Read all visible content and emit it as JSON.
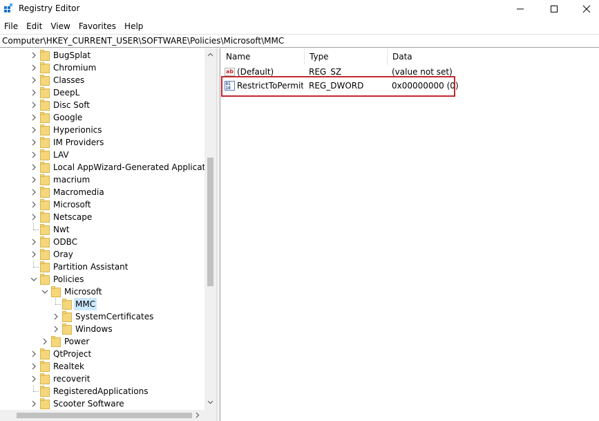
{
  "window": {
    "title": "Registry Editor",
    "controls": {
      "minimize": "minimize",
      "maximize": "maximize",
      "close": "close"
    }
  },
  "menu": [
    "File",
    "Edit",
    "View",
    "Favorites",
    "Help"
  ],
  "address": "Computer\\HKEY_CURRENT_USER\\SOFTWARE\\Policies\\Microsoft\\MMC",
  "tree": {
    "items": [
      {
        "label": "BugSplat",
        "level": 0,
        "expander": "collapsed"
      },
      {
        "label": "Chromium",
        "level": 0,
        "expander": "collapsed"
      },
      {
        "label": "Classes",
        "level": 0,
        "expander": "collapsed"
      },
      {
        "label": "DeepL",
        "level": 0,
        "expander": "collapsed"
      },
      {
        "label": "Disc Soft",
        "level": 0,
        "expander": "collapsed"
      },
      {
        "label": "Google",
        "level": 0,
        "expander": "collapsed"
      },
      {
        "label": "Hyperionics",
        "level": 0,
        "expander": "collapsed"
      },
      {
        "label": "IM Providers",
        "level": 0,
        "expander": "collapsed"
      },
      {
        "label": "LAV",
        "level": 0,
        "expander": "collapsed"
      },
      {
        "label": "Local AppWizard-Generated Applications",
        "level": 0,
        "expander": "collapsed"
      },
      {
        "label": "macrium",
        "level": 0,
        "expander": "collapsed"
      },
      {
        "label": "Macromedia",
        "level": 0,
        "expander": "collapsed"
      },
      {
        "label": "Microsoft",
        "level": 0,
        "expander": "collapsed"
      },
      {
        "label": "Netscape",
        "level": 0,
        "expander": "collapsed"
      },
      {
        "label": "Nwt",
        "level": 0,
        "expander": "none"
      },
      {
        "label": "ODBC",
        "level": 0,
        "expander": "collapsed"
      },
      {
        "label": "Oray",
        "level": 0,
        "expander": "collapsed"
      },
      {
        "label": "Partition Assistant",
        "level": 0,
        "expander": "none"
      },
      {
        "label": "Policies",
        "level": 0,
        "expander": "expanded"
      },
      {
        "label": "Microsoft",
        "level": 1,
        "expander": "expanded"
      },
      {
        "label": "MMC",
        "level": 2,
        "expander": "none",
        "selected": true
      },
      {
        "label": "SystemCertificates",
        "level": 2,
        "expander": "collapsed"
      },
      {
        "label": "Windows",
        "level": 2,
        "expander": "collapsed"
      },
      {
        "label": "Power",
        "level": 1,
        "expander": "collapsed"
      },
      {
        "label": "QtProject",
        "level": 0,
        "expander": "collapsed"
      },
      {
        "label": "Realtek",
        "level": 0,
        "expander": "collapsed"
      },
      {
        "label": "recoverit",
        "level": 0,
        "expander": "collapsed"
      },
      {
        "label": "RegisteredApplications",
        "level": 0,
        "expander": "none"
      },
      {
        "label": "Scooter Software",
        "level": 0,
        "expander": "collapsed"
      }
    ]
  },
  "values": {
    "columns": {
      "name": "Name",
      "type": "Type",
      "data": "Data"
    },
    "rows": [
      {
        "icon": "string-value-icon",
        "name": "(Default)",
        "type": "REG_SZ",
        "data": "(value not set)"
      },
      {
        "icon": "dword-value-icon",
        "name": "RestrictToPermit...",
        "type": "REG_DWORD",
        "data": "0x00000000 (0)",
        "highlighted": true
      }
    ]
  },
  "colors": {
    "selection": "#cce8ff",
    "folder": "#f5d67a",
    "highlight_border": "#c0282e"
  }
}
